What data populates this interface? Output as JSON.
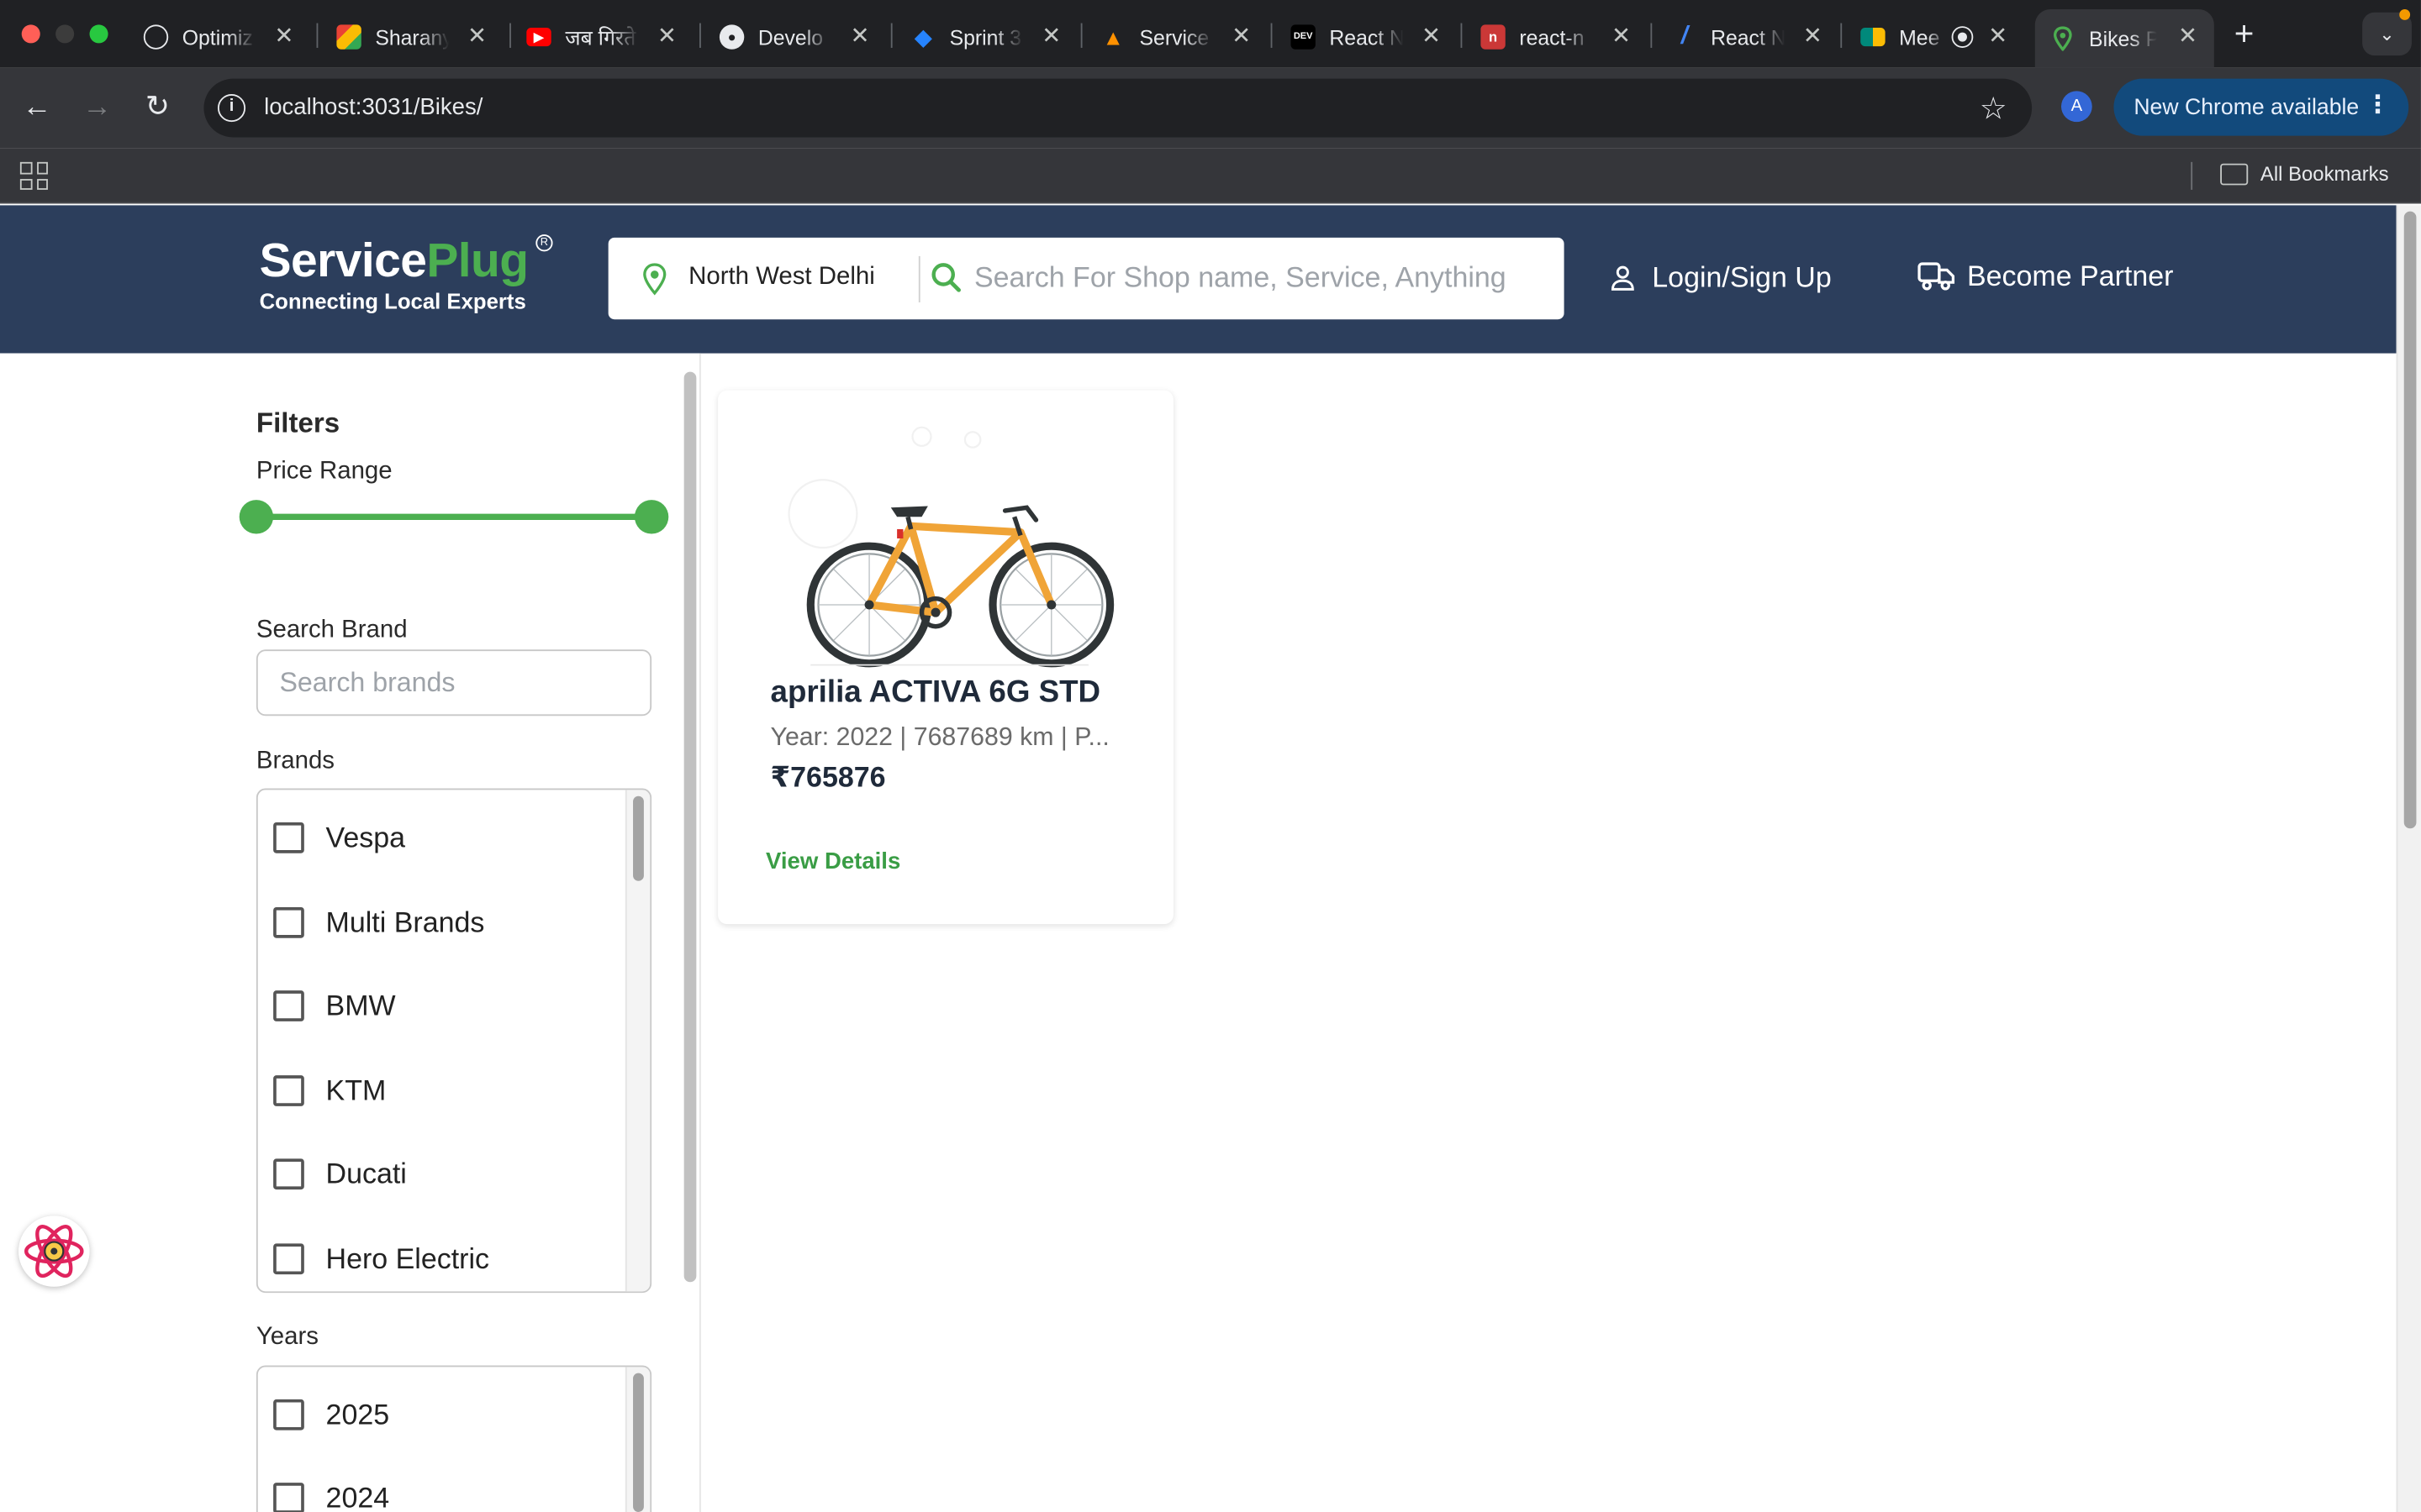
{
  "browser": {
    "tabs": [
      {
        "title": "Optimiz",
        "icon": "openai-icon",
        "color": "#e8eaed"
      },
      {
        "title": "Sharany",
        "icon": "colorful-app-icon",
        "color": "#34a853"
      },
      {
        "title": "जब गिरते",
        "icon": "youtube-icon",
        "color": "#ff0000"
      },
      {
        "title": "Develo",
        "icon": "github-icon",
        "color": "#e8eaed"
      },
      {
        "title": "Sprint 3",
        "icon": "jira-icon",
        "color": "#2684ff"
      },
      {
        "title": "Service",
        "icon": "firebase-icon",
        "color": "#ff9100"
      },
      {
        "title": "React N",
        "icon": "dev-icon",
        "color": "#000000"
      },
      {
        "title": "react-n",
        "icon": "npm-icon",
        "color": "#cb3837"
      },
      {
        "title": "React N",
        "icon": "feather-icon",
        "color": "#4285f4"
      },
      {
        "title": "Mee",
        "icon": "meet-icon",
        "color": "#00897b"
      },
      {
        "title": "Bikes P",
        "icon": "map-pin-icon",
        "color": "#4caf50"
      }
    ],
    "url": "localhost:3031/Bikes/",
    "profile_initial": "A",
    "update_label": "New Chrome available",
    "bookmarks_label": "All Bookmarks"
  },
  "header": {
    "brand_part1": "Service",
    "brand_part2": "Plug",
    "registered": "R",
    "tagline": "Connecting Local Experts",
    "location": "North West Delhi",
    "search_placeholder": "Search For Shop name, Service, Anything",
    "login_label": "Login/Sign Up",
    "partner_label": "Become Partner",
    "accent_color": "#4caf50",
    "header_color": "#2c3e5c"
  },
  "filters": {
    "title": "Filters",
    "price_label": "Price Range",
    "price_range": {
      "min_fraction": 0.0,
      "max_fraction": 1.0
    },
    "brand_search_label": "Search Brand",
    "brand_search_placeholder": "Search brands",
    "brands_label": "Brands",
    "brands": [
      "Vespa",
      "Multi Brands",
      "BMW",
      "KTM",
      "Ducati",
      "Hero Electric"
    ],
    "years_label": "Years",
    "years": [
      "2025",
      "2024"
    ]
  },
  "listing": {
    "name": "aprilia ACTIVA 6G STD",
    "meta": "Year: 2022 | 7687689 km | P...",
    "price": "₹765876",
    "cta": "View Details"
  }
}
